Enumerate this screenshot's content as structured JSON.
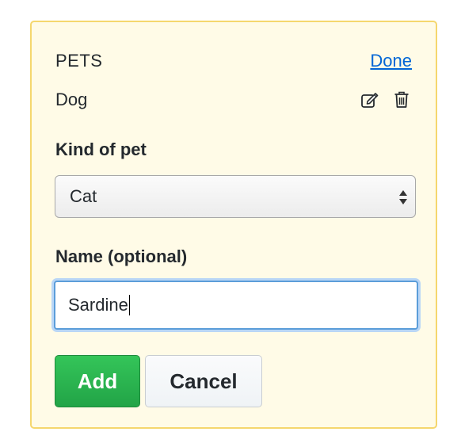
{
  "panel": {
    "title": "PETS",
    "done_label": "Done"
  },
  "pet_item": {
    "name": "Dog",
    "edit_icon": "edit-icon",
    "delete_icon": "trash-icon"
  },
  "form": {
    "kind_label": "Kind of pet",
    "kind_selected": "Cat",
    "name_label": "Name (optional)",
    "name_value": "Sardine"
  },
  "buttons": {
    "add_label": "Add",
    "cancel_label": "Cancel"
  },
  "colors": {
    "panel_bg": "#fffbe7",
    "panel_border": "#f5d76e",
    "link": "#0366d6",
    "add_green": "#2ebc4f",
    "focus_ring": "#5b9dd9"
  }
}
